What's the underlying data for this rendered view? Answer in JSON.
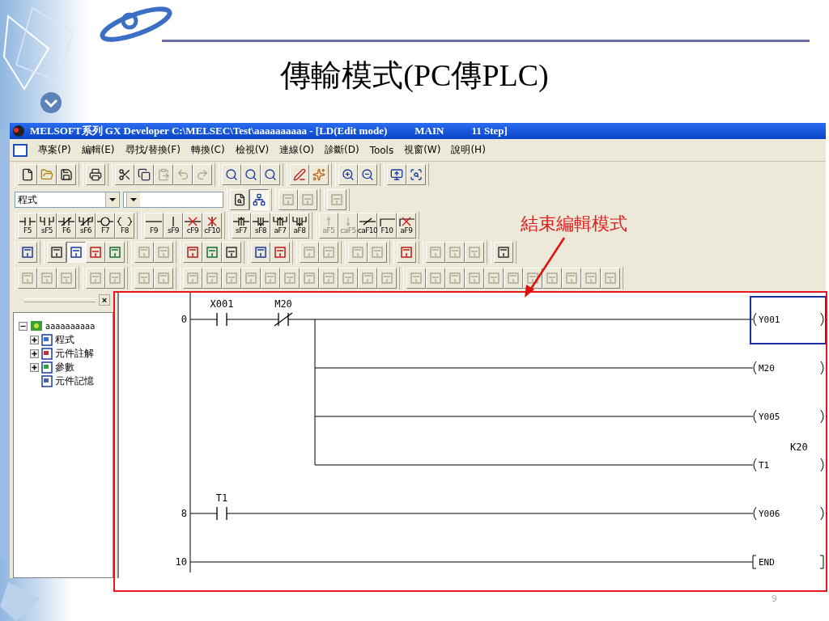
{
  "slide": {
    "title": "傳輸模式(PC傳PLC)",
    "annotation": "結束編輯模式",
    "page_number": "9"
  },
  "window": {
    "title": "MELSOFT系列 GX Developer C:\\MELSEC\\Test\\aaaaaaaaaa - [LD(Edit mode)",
    "program": "MAIN",
    "steps": "11 Step]"
  },
  "menu": [
    "專案(P)",
    "編輯(E)",
    "尋找/替換(F)",
    "轉換(C)",
    "檢視(V)",
    "連線(O)",
    "診斷(D)",
    "Tools",
    "視窗(W)",
    "說明(H)"
  ],
  "toolbar_1": [
    [
      {
        "disabled": false
      },
      {
        "disabled": false
      },
      {
        "disabled": false
      }
    ],
    [
      {
        "disabled": false
      }
    ],
    [
      {
        "disabled": false
      },
      {
        "disabled": false
      },
      {
        "disabled": true
      },
      {
        "disabled": true
      },
      {
        "disabled": true
      }
    ],
    [
      {
        "disabled": false
      },
      {
        "disabled": false
      },
      {
        "disabled": false
      }
    ],
    [
      {
        "disabled": false
      },
      {
        "disabled": false
      }
    ],
    [
      {
        "disabled": false
      },
      {
        "disabled": false
      }
    ],
    [
      {
        "disabled": false
      },
      {
        "disabled": false
      }
    ]
  ],
  "program_selector": {
    "value": "程式"
  },
  "toolbar_2": [
    [
      {
        "disabled": false,
        "pressed": false
      },
      {
        "disabled": false,
        "pressed": true
      }
    ],
    [
      {
        "disabled": true,
        "pressed": false
      },
      {
        "disabled": true,
        "pressed": false
      }
    ],
    [
      {
        "disabled": true,
        "pressed": false
      }
    ]
  ],
  "function_keys": [
    [
      {
        "label": "F5",
        "kind": "contact-no",
        "disabled": false
      },
      {
        "label": "sF5",
        "kind": "contact-no-parallel",
        "disabled": false
      },
      {
        "label": "F6",
        "kind": "contact-nc",
        "disabled": false
      },
      {
        "label": "sF6",
        "kind": "contact-nc-parallel",
        "disabled": false
      },
      {
        "label": "F7",
        "kind": "coil",
        "disabled": false
      },
      {
        "label": "F8",
        "kind": "function",
        "disabled": false
      }
    ],
    [
      {
        "label": "F9",
        "kind": "hline",
        "disabled": false
      },
      {
        "label": "sF9",
        "kind": "vline",
        "disabled": false
      },
      {
        "label": "cF9",
        "kind": "delete-hline",
        "disabled": false
      },
      {
        "label": "cF10",
        "kind": "delete-vline",
        "disabled": false
      }
    ],
    [
      {
        "label": "sF7",
        "kind": "pulse-rise",
        "disabled": false
      },
      {
        "label": "sF8",
        "kind": "pulse-fall",
        "disabled": false
      },
      {
        "label": "aF7",
        "kind": "pulse-rise-parallel",
        "disabled": false
      },
      {
        "label": "aF8",
        "kind": "pulse-fall-parallel",
        "disabled": false
      }
    ],
    [
      {
        "label": "aF5",
        "kind": "up",
        "disabled": true
      },
      {
        "label": "caF5",
        "kind": "down",
        "disabled": true
      },
      {
        "label": "caF10",
        "kind": "invert",
        "disabled": false
      },
      {
        "label": "F10",
        "kind": "line-draw",
        "disabled": false
      },
      {
        "label": "aF9",
        "kind": "line-delete",
        "disabled": false
      }
    ]
  ],
  "toolbar_4": [
    [
      {
        "disabled": false,
        "pressed": false
      }
    ],
    [
      {
        "disabled": false,
        "pressed": false
      },
      {
        "disabled": false,
        "pressed": true
      },
      {
        "disabled": false,
        "pressed": false
      },
      {
        "disabled": false,
        "pressed": false
      }
    ],
    [
      {
        "disabled": true,
        "pressed": false
      },
      {
        "disabled": true,
        "pressed": false
      }
    ],
    [
      {
        "disabled": false,
        "pressed": false
      },
      {
        "disabled": false,
        "pressed": false
      },
      {
        "disabled": false,
        "pressed": false
      }
    ],
    [
      {
        "disabled": false,
        "pressed": false
      },
      {
        "disabled": false,
        "pressed": false
      }
    ],
    [
      {
        "disabled": true,
        "pressed": false
      },
      {
        "disabled": true,
        "pressed": false
      }
    ],
    [
      {
        "disabled": true,
        "pressed": false
      },
      {
        "disabled": true,
        "pressed": false
      }
    ],
    [
      {
        "disabled": false,
        "pressed": false
      }
    ],
    [
      {
        "disabled": true,
        "pressed": false
      },
      {
        "disabled": true,
        "pressed": false
      },
      {
        "disabled": true,
        "pressed": false
      }
    ],
    [
      {
        "disabled": false,
        "pressed": false
      }
    ]
  ],
  "toolbar_5": [
    [
      {
        "disabled": true
      },
      {
        "disabled": true
      },
      {
        "disabled": true
      }
    ],
    [
      {
        "disabled": true
      },
      {
        "disabled": true
      }
    ],
    [
      {
        "disabled": true
      },
      {
        "disabled": true
      }
    ],
    [
      {
        "disabled": true
      },
      {
        "disabled": true
      },
      {
        "disabled": true
      },
      {
        "disabled": true
      },
      {
        "disabled": true
      },
      {
        "disabled": true
      },
      {
        "disabled": true
      },
      {
        "disabled": true
      },
      {
        "disabled": true
      },
      {
        "disabled": true
      },
      {
        "disabled": true
      }
    ],
    [
      {
        "disabled": true
      },
      {
        "disabled": true
      },
      {
        "disabled": true
      },
      {
        "disabled": true
      },
      {
        "disabled": true
      },
      {
        "disabled": true
      },
      {
        "disabled": true
      },
      {
        "disabled": true
      },
      {
        "disabled": true
      },
      {
        "disabled": true
      },
      {
        "disabled": true
      }
    ]
  ],
  "pane_close": "×",
  "project_tree": {
    "label": "aaaaaaaaaa",
    "expanded": true,
    "children": [
      {
        "label": "程式",
        "expanded": false
      },
      {
        "label": "元件註解",
        "expanded": false
      },
      {
        "label": "參數",
        "expanded": false
      },
      {
        "label": "元件記憶"
      }
    ]
  },
  "ladder": [
    {
      "step": "0",
      "contacts": [
        {
          "device": "X001",
          "kind": "no"
        },
        {
          "device": "M20",
          "kind": "nc"
        }
      ],
      "outputs": [
        {
          "device": "Y001",
          "kind": "coil",
          "selected": true
        },
        {
          "device": "M20",
          "kind": "coil",
          "selected": false
        },
        {
          "device": "Y005",
          "kind": "coil",
          "selected": false
        },
        {
          "device": "T1",
          "kind": "coil",
          "setting": "K20",
          "selected": false
        }
      ]
    },
    {
      "step": "8",
      "contacts": [
        {
          "device": "T1",
          "kind": "no"
        }
      ],
      "outputs": [
        {
          "device": "Y006",
          "kind": "coil",
          "selected": false
        }
      ]
    },
    {
      "step": "10",
      "outputs": [
        {
          "device": "END",
          "kind": "instruction",
          "selected": false
        }
      ]
    }
  ]
}
